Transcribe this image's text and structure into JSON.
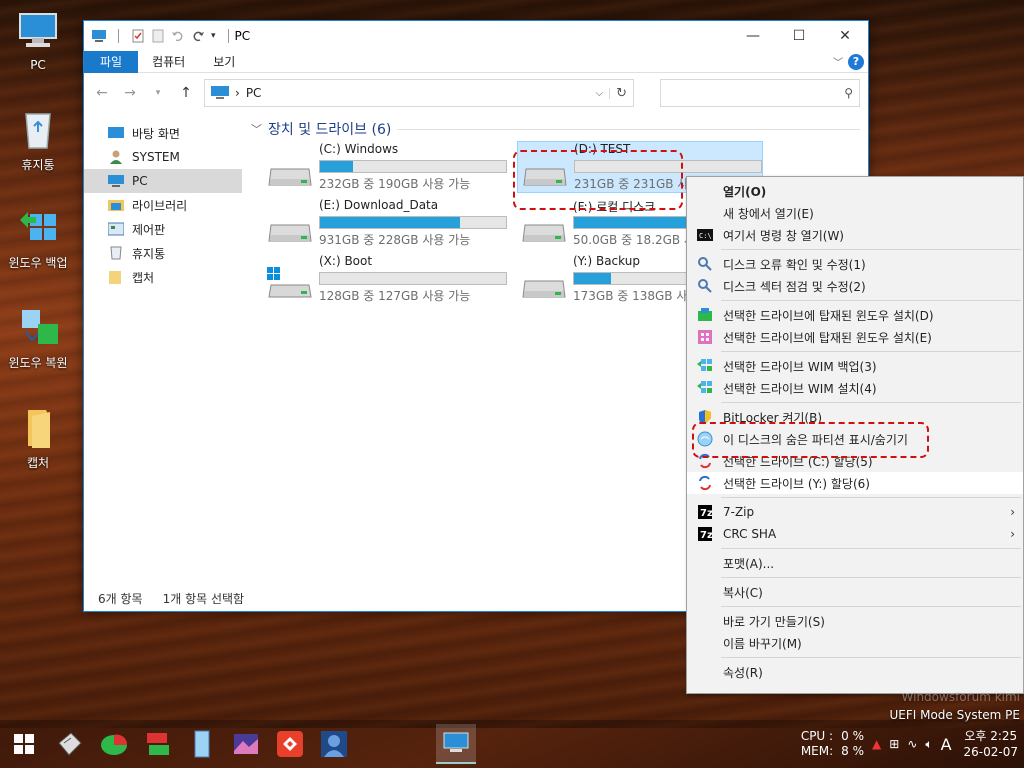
{
  "desktop": {
    "icons": [
      {
        "label": "PC"
      },
      {
        "label": "휴지통"
      },
      {
        "label": "윈도우 백업"
      },
      {
        "label": "윈도우 복원"
      },
      {
        "label": "캡처"
      }
    ]
  },
  "window": {
    "title": "PC",
    "ribbon_tabs": [
      "파일",
      "컴퓨터",
      "보기"
    ],
    "address": "PC",
    "sidebar": [
      "바탕 화면",
      "SYSTEM",
      "PC",
      "라이브러리",
      "제어판",
      "휴지통",
      "캡처"
    ],
    "group_header": "장치 및 드라이브 (6)",
    "drives": [
      {
        "name": "(C:) Windows",
        "size": "232GB 중 190GB 사용 가능",
        "used_fraction": 0.18
      },
      {
        "name": "(D:) TEST",
        "size": "231GB 중 231GB 사용 가능",
        "used_fraction": 0.0
      },
      {
        "name": "(E:) Download_Data",
        "size": "931GB 중 228GB 사용 가능",
        "used_fraction": 0.75
      },
      {
        "name": "(F:) 로컬 디스크",
        "size": "50.0GB 중 18.2GB 사용 가능",
        "used_fraction": 0.64
      },
      {
        "name": "(X:) Boot",
        "size": "128GB 중 127GB 사용 가능",
        "used_fraction": 0.0
      },
      {
        "name": "(Y:) Backup",
        "size": "173GB 중 138GB 사용 가능",
        "used_fraction": 0.2
      }
    ],
    "status": {
      "count": "6개 항목",
      "selected": "1개 항목 선택함"
    }
  },
  "context_menu": {
    "items": [
      {
        "label": "열기(O)",
        "bold": true
      },
      {
        "label": "새 창에서 열기(E)"
      },
      {
        "label": "여기서 명령 창 열기(W)"
      },
      {
        "sep": true
      },
      {
        "label": "디스크 오류 확인 및 수정(1)"
      },
      {
        "label": "디스크 섹터 점검 및 수정(2)"
      },
      {
        "sep": true
      },
      {
        "label": "선택한 드라이브에 탑재된 윈도우 설치(D)"
      },
      {
        "label": "선택한 드라이브에 탑재된 윈도우 설치(E)"
      },
      {
        "sep": true
      },
      {
        "label": "선택한 드라이브 WIM 백업(3)"
      },
      {
        "label": "선택한 드라이브 WIM 설치(4)"
      },
      {
        "sep": true
      },
      {
        "label": "BitLocker 켜기(B)"
      },
      {
        "label": "이 디스크의 숨은 파티션 표시/숨기기"
      },
      {
        "label": "선택한 드라이브  (C:)  할당(5)"
      },
      {
        "label": "선택한 드라이브  (Y:)  할당(6)",
        "highlight": true
      },
      {
        "sep": true
      },
      {
        "label": "7-Zip",
        "submenu": true
      },
      {
        "label": "CRC SHA",
        "submenu": true
      },
      {
        "sep": true
      },
      {
        "label": "포맷(A)..."
      },
      {
        "sep": true
      },
      {
        "label": "복사(C)"
      },
      {
        "sep": true
      },
      {
        "label": "바로 가기 만들기(S)"
      },
      {
        "label": "이름 바꾸기(M)"
      },
      {
        "sep": true
      },
      {
        "label": "속성(R)"
      }
    ]
  },
  "watermark": {
    "line1": "Windowsforum kimi",
    "line2": "UEFI Mode System PE"
  },
  "tray": {
    "cpu_label": "CPU :",
    "cpu_value": "0 %",
    "mem_label": "MEM:",
    "mem_value": "8 %",
    "ime": "A",
    "time": "오후 2:25",
    "date": "26-02-07"
  }
}
